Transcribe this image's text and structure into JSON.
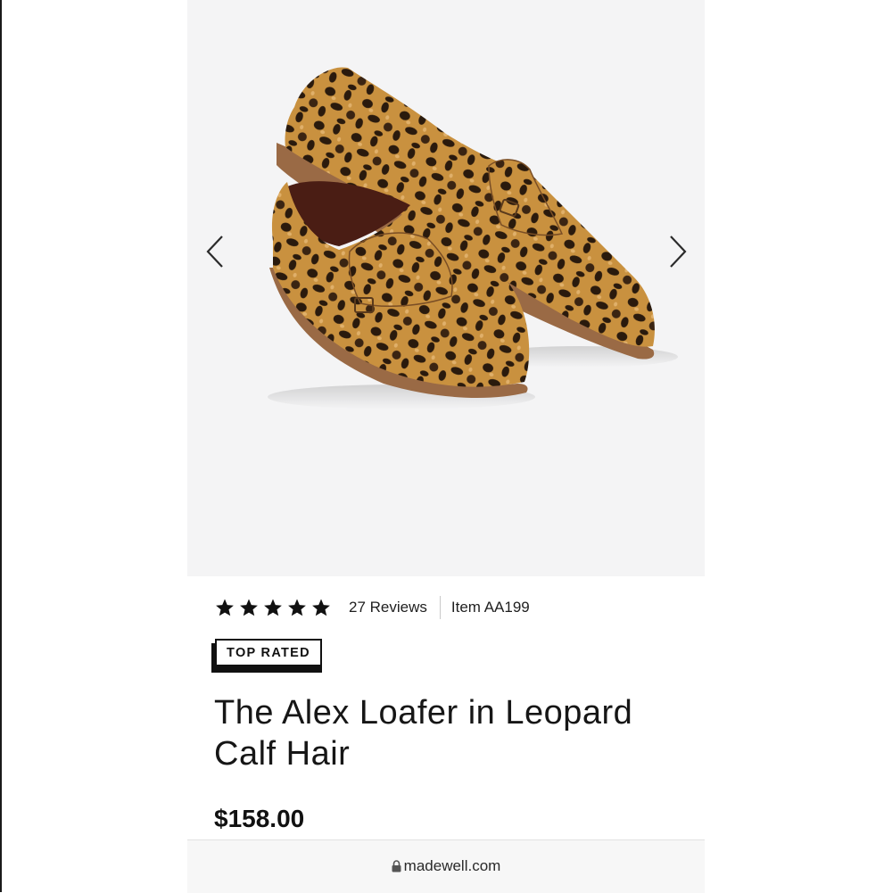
{
  "product": {
    "rating_stars": 5,
    "reviews_label": "27 Reviews",
    "item_label": "Item AA199",
    "badge": "TOP RATED",
    "title": "The Alex Loafer in Leopard Calf Hair",
    "price": "$158.00"
  },
  "gallery": {
    "prev_icon": "chevron-left-icon",
    "next_icon": "chevron-right-icon",
    "background": "#f4f4f5"
  },
  "browser": {
    "url": "madewell.com",
    "lock_icon": "lock-icon"
  },
  "colors": {
    "leopard_base": "#c9913f",
    "spots": "#2a1a0d",
    "sole": "#9a6a45",
    "text": "#141414"
  }
}
